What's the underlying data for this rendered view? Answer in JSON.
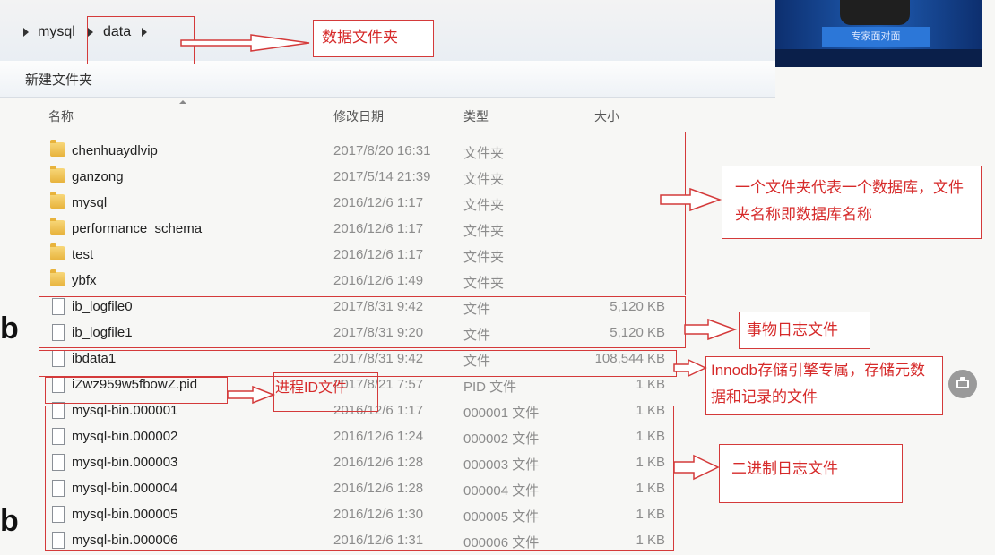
{
  "breadcrumb": {
    "items": [
      {
        "label": "mysql"
      },
      {
        "label": "data"
      }
    ]
  },
  "toolbar": {
    "new_folder_label": "新建文件夹"
  },
  "columns": {
    "name": "名称",
    "date": "修改日期",
    "type": "类型",
    "size": "大小"
  },
  "files": [
    {
      "name": "chenhuaydlvip",
      "date": "2017/8/20 16:31",
      "type": "文件夹",
      "size": "",
      "icon": "folder-icon"
    },
    {
      "name": "ganzong",
      "date": "2017/5/14 21:39",
      "type": "文件夹",
      "size": "",
      "icon": "folder-icon"
    },
    {
      "name": "mysql",
      "date": "2016/12/6 1:17",
      "type": "文件夹",
      "size": "",
      "icon": "folder-icon"
    },
    {
      "name": "performance_schema",
      "date": "2016/12/6 1:17",
      "type": "文件夹",
      "size": "",
      "icon": "folder-icon"
    },
    {
      "name": "test",
      "date": "2016/12/6 1:17",
      "type": "文件夹",
      "size": "",
      "icon": "folder-icon"
    },
    {
      "name": "ybfx",
      "date": "2016/12/6 1:49",
      "type": "文件夹",
      "size": "",
      "icon": "folder-icon"
    },
    {
      "name": "ib_logfile0",
      "date": "2017/8/31 9:42",
      "type": "文件",
      "size": "5,120 KB",
      "icon": "file-icon"
    },
    {
      "name": "ib_logfile1",
      "date": "2017/8/31 9:20",
      "type": "文件",
      "size": "5,120 KB",
      "icon": "file-icon"
    },
    {
      "name": "ibdata1",
      "date": "2017/8/31 9:42",
      "type": "文件",
      "size": "108,544 KB",
      "icon": "file-icon"
    },
    {
      "name": "iZwz959w5fbowZ.pid",
      "date": "2017/8/21 7:57",
      "type": "PID 文件",
      "size": "1 KB",
      "icon": "file-icon"
    },
    {
      "name": "mysql-bin.000001",
      "date": "2016/12/6 1:17",
      "type": "000001 文件",
      "size": "1 KB",
      "icon": "file-icon"
    },
    {
      "name": "mysql-bin.000002",
      "date": "2016/12/6 1:24",
      "type": "000002 文件",
      "size": "1 KB",
      "icon": "file-icon"
    },
    {
      "name": "mysql-bin.000003",
      "date": "2016/12/6 1:28",
      "type": "000003 文件",
      "size": "1 KB",
      "icon": "file-icon"
    },
    {
      "name": "mysql-bin.000004",
      "date": "2016/12/6 1:28",
      "type": "000004 文件",
      "size": "1 KB",
      "icon": "file-icon"
    },
    {
      "name": "mysql-bin.000005",
      "date": "2016/12/6 1:30",
      "type": "000005 文件",
      "size": "1 KB",
      "icon": "file-icon"
    },
    {
      "name": "mysql-bin.000006",
      "date": "2016/12/6 1:31",
      "type": "000006 文件",
      "size": "1 KB",
      "icon": "file-icon"
    }
  ],
  "annotations": {
    "data_folder": "数据文件夹",
    "database_note": "一个文件夹代表一个数据库，文件夹名称即数据库名称",
    "transaction_log": "事物日志文件",
    "innodb_note": "Innodb存储引擎专属，存储元数据和记录的文件",
    "pid_note": "进程ID文件",
    "binlog_note": "二进制日志文件",
    "accent_color": "#d43a3a"
  },
  "video_overlay": {
    "banner": "专家面对面"
  },
  "edge_letters": [
    "b",
    "b"
  ]
}
